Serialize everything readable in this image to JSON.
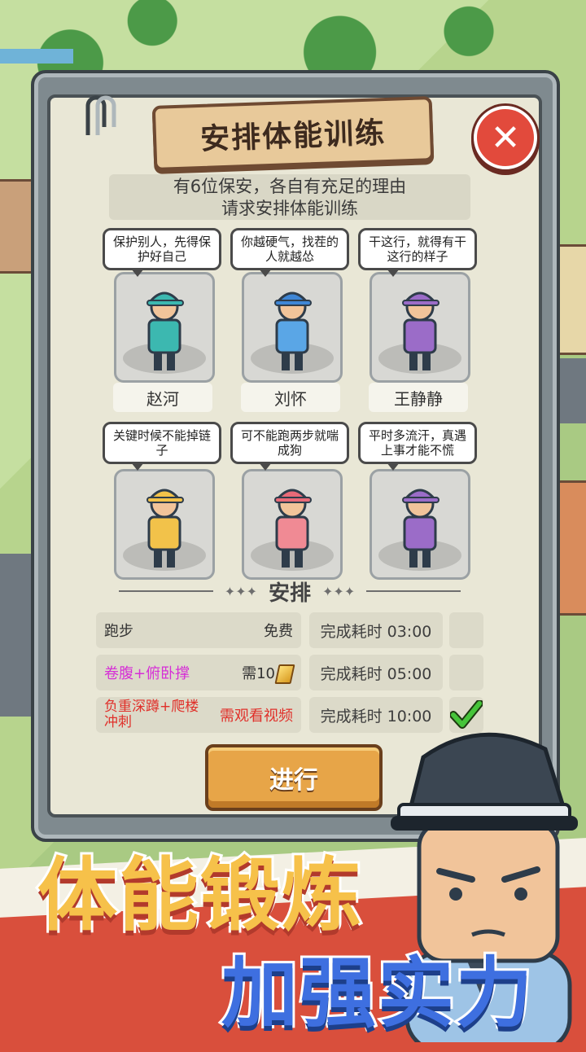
{
  "dialog": {
    "title": "安排体能训练",
    "description_line1": "有6位保安，各自有充足的理由",
    "description_line2": "请求安排体能训练"
  },
  "guards": [
    {
      "name": "赵河",
      "quote": "保护别人，先得保护好自己",
      "cap_color": "#3cb8b0",
      "shirt_color": "#3cb8b0"
    },
    {
      "name": "刘怀",
      "quote": "你越硬气，找茬的人就越怂",
      "cap_color": "#3e86d6",
      "shirt_color": "#5aa6e6"
    },
    {
      "name": "王静静",
      "quote": "干这行，就得有干这行的样子",
      "cap_color": "#9b6cc8",
      "shirt_color": "#9b6cc8"
    },
    {
      "name": "",
      "quote": "关键时候不能掉链子",
      "cap_color": "#f2c24a",
      "shirt_color": "#f2c24a"
    },
    {
      "name": "",
      "quote": "可不能跑两步就喘成狗",
      "cap_color": "#e86a78",
      "shirt_color": "#f08a94"
    },
    {
      "name": "",
      "quote": "平时多流汗，真遇上事才能不慌",
      "cap_color": "#9b6cc8",
      "shirt_color": "#9b6cc8"
    }
  ],
  "section_label": "安排",
  "options": [
    {
      "name": "跑步",
      "cost": "免费",
      "time": "完成耗时 03:00",
      "selected": false,
      "name_color": "#333333",
      "cost_color": "#333333"
    },
    {
      "name": "卷腹+俯卧撑",
      "cost": "需10",
      "time": "完成耗时 05:00",
      "selected": false,
      "name_color": "#d62fd6",
      "cost_color": "#333333"
    },
    {
      "name": "负重深蹲+爬楼冲刺",
      "cost": "需观看视频",
      "time": "完成耗时 10:00",
      "selected": true,
      "name_color": "#e0302a",
      "cost_color": "#e0302a"
    }
  ],
  "go_button": "进行",
  "close_icon": "close-icon",
  "slogan_main": "体能锻炼",
  "slogan_sub": "加强实力"
}
